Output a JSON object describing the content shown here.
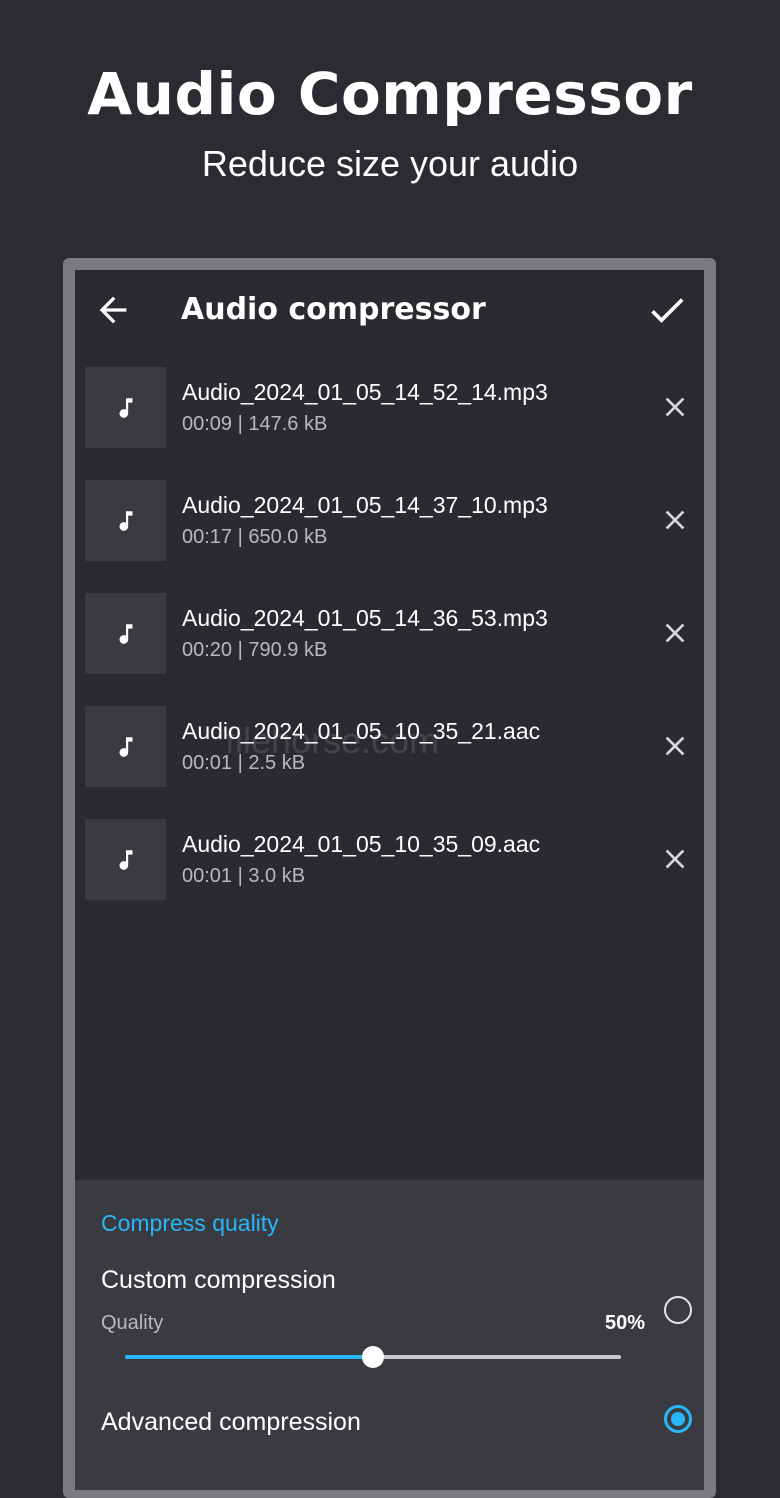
{
  "promo": {
    "title": "Audio Compressor",
    "subtitle": "Reduce size your audio"
  },
  "appbar": {
    "title": "Audio compressor",
    "back_icon": "arrow-left-icon",
    "confirm_icon": "check-icon"
  },
  "files": [
    {
      "name": "Audio_2024_01_05_14_52_14.mp3",
      "meta": "00:09 | 147.6 kB"
    },
    {
      "name": "Audio_2024_01_05_14_37_10.mp3",
      "meta": "00:17 | 650.0 kB"
    },
    {
      "name": "Audio_2024_01_05_14_36_53.mp3",
      "meta": "00:20 | 790.9 kB"
    },
    {
      "name": "Audio_2024_01_05_10_35_21.aac",
      "meta": "00:01 | 2.5 kB"
    },
    {
      "name": "Audio_2024_01_05_10_35_09.aac",
      "meta": "00:01 | 3.0 kB"
    }
  ],
  "watermark": "filehorse.com",
  "compress": {
    "heading": "Compress quality",
    "custom": {
      "title": "Custom compression",
      "quality_label": "Quality",
      "quality_value": "50%",
      "quality_fraction": 0.5,
      "selected": false
    },
    "advanced": {
      "title": "Advanced compression",
      "selected": true
    }
  },
  "colors": {
    "accent": "#29b6f6",
    "background": "#2b2c32",
    "panel": "#3a3b41"
  }
}
